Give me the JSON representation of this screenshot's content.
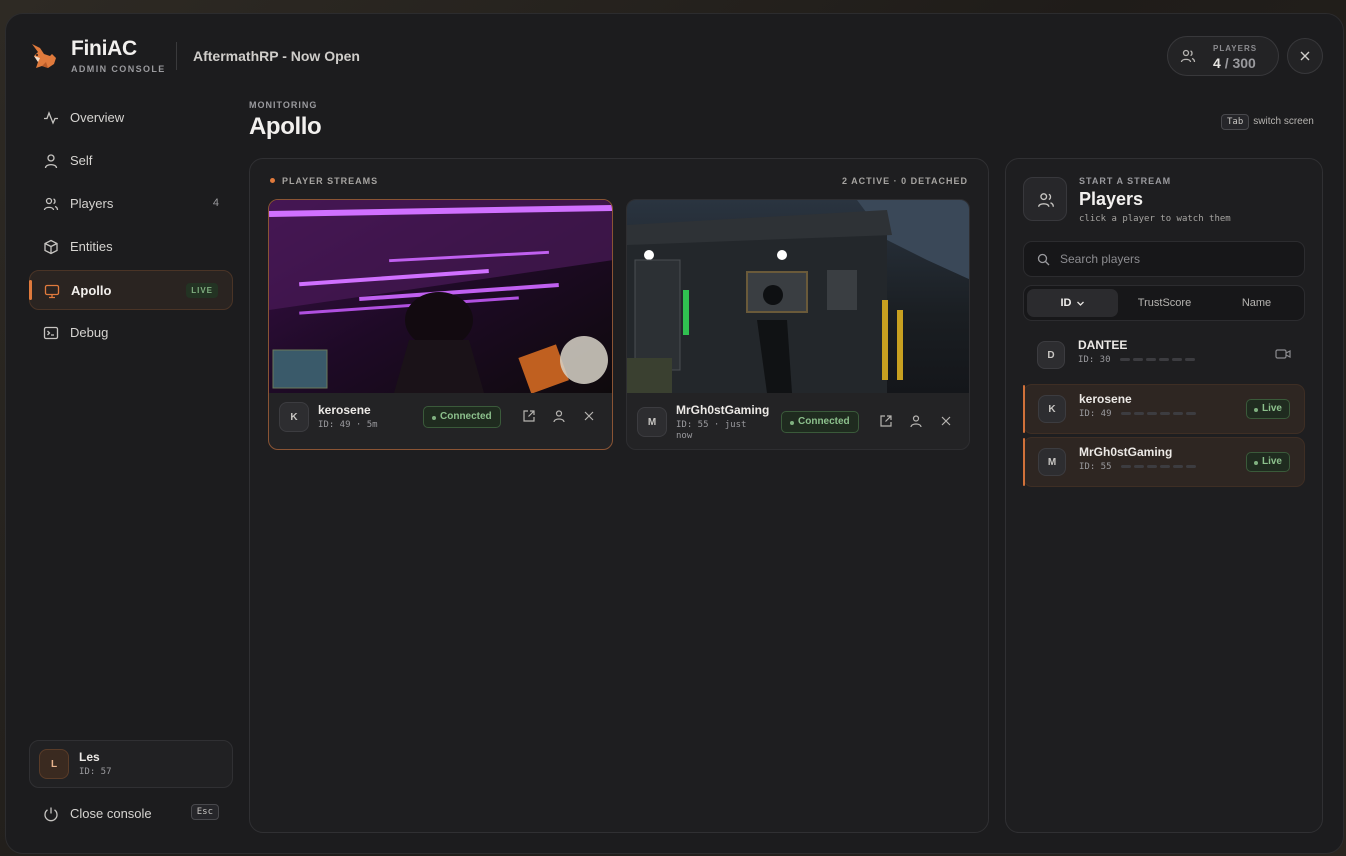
{
  "header": {
    "brand_name": "FiniAC",
    "brand_sub": "ADMIN CONSOLE",
    "server_name": "AftermathRP - Now Open",
    "players_label": "PLAYERS",
    "players_current": "4",
    "players_max": "/ 300"
  },
  "sidebar": {
    "items": [
      {
        "label": "Overview",
        "icon": "activity-icon"
      },
      {
        "label": "Self",
        "icon": "user-icon"
      },
      {
        "label": "Players",
        "icon": "users-icon",
        "count": "4"
      },
      {
        "label": "Entities",
        "icon": "cube-icon"
      },
      {
        "label": "Apollo",
        "icon": "monitor-icon",
        "badge": "LIVE",
        "active": true
      },
      {
        "label": "Debug",
        "icon": "terminal-icon"
      }
    ],
    "user": {
      "initial": "L",
      "name": "Les",
      "id": "ID: 57"
    },
    "close_label": "Close console",
    "close_key": "Esc"
  },
  "main": {
    "section_label": "MONITORING",
    "title": "Apollo",
    "hint_key": "Tab",
    "hint_label": "switch screen"
  },
  "streams": {
    "title": "PLAYER STREAMS",
    "status": "2 ACTIVE · 0 DETACHED",
    "cards": [
      {
        "initial": "K",
        "name": "kerosene",
        "meta": "ID: 49 · 5m",
        "status": "Connected"
      },
      {
        "initial": "M",
        "name": "MrGh0stGaming",
        "meta": "ID: 55 · just now",
        "status": "Connected"
      }
    ]
  },
  "players_panel": {
    "label": "START A STREAM",
    "title": "Players",
    "subtitle": "click a player to watch them",
    "search_placeholder": "Search players",
    "sort": [
      "ID",
      "TrustScore",
      "Name"
    ],
    "rows": [
      {
        "initial": "D",
        "name": "DANTEE",
        "id": "ID: 30",
        "live": false
      },
      {
        "initial": "K",
        "name": "kerosene",
        "id": "ID: 49",
        "live": true,
        "live_label": "Live"
      },
      {
        "initial": "M",
        "name": "MrGh0stGaming",
        "id": "ID: 55",
        "live": true,
        "live_label": "Live"
      }
    ]
  },
  "colors": {
    "accent": "#e07a3c",
    "live_green": "#8cc08c",
    "panel_bg": "#1e1e20"
  }
}
